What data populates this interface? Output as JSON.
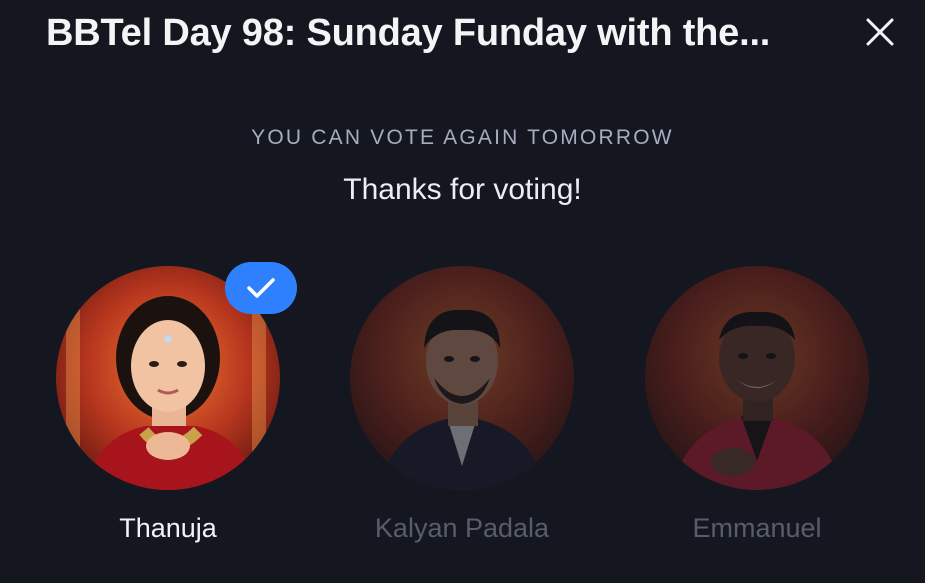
{
  "header": {
    "title": "BBTel Day 98: Sunday Funday with the...",
    "close_icon": "close-icon"
  },
  "poll": {
    "notice": "YOU CAN VOTE AGAIN TOMORROW",
    "thanks": "Thanks for voting!"
  },
  "candidates": [
    {
      "name": "Thanuja",
      "selected": true,
      "icon": "check-icon"
    },
    {
      "name": "Kalyan Padala",
      "selected": false
    },
    {
      "name": "Emmanuel",
      "selected": false
    }
  ],
  "colors": {
    "background": "#14171f",
    "accent": "#2f80ff",
    "muted_text": "#585c6b"
  }
}
